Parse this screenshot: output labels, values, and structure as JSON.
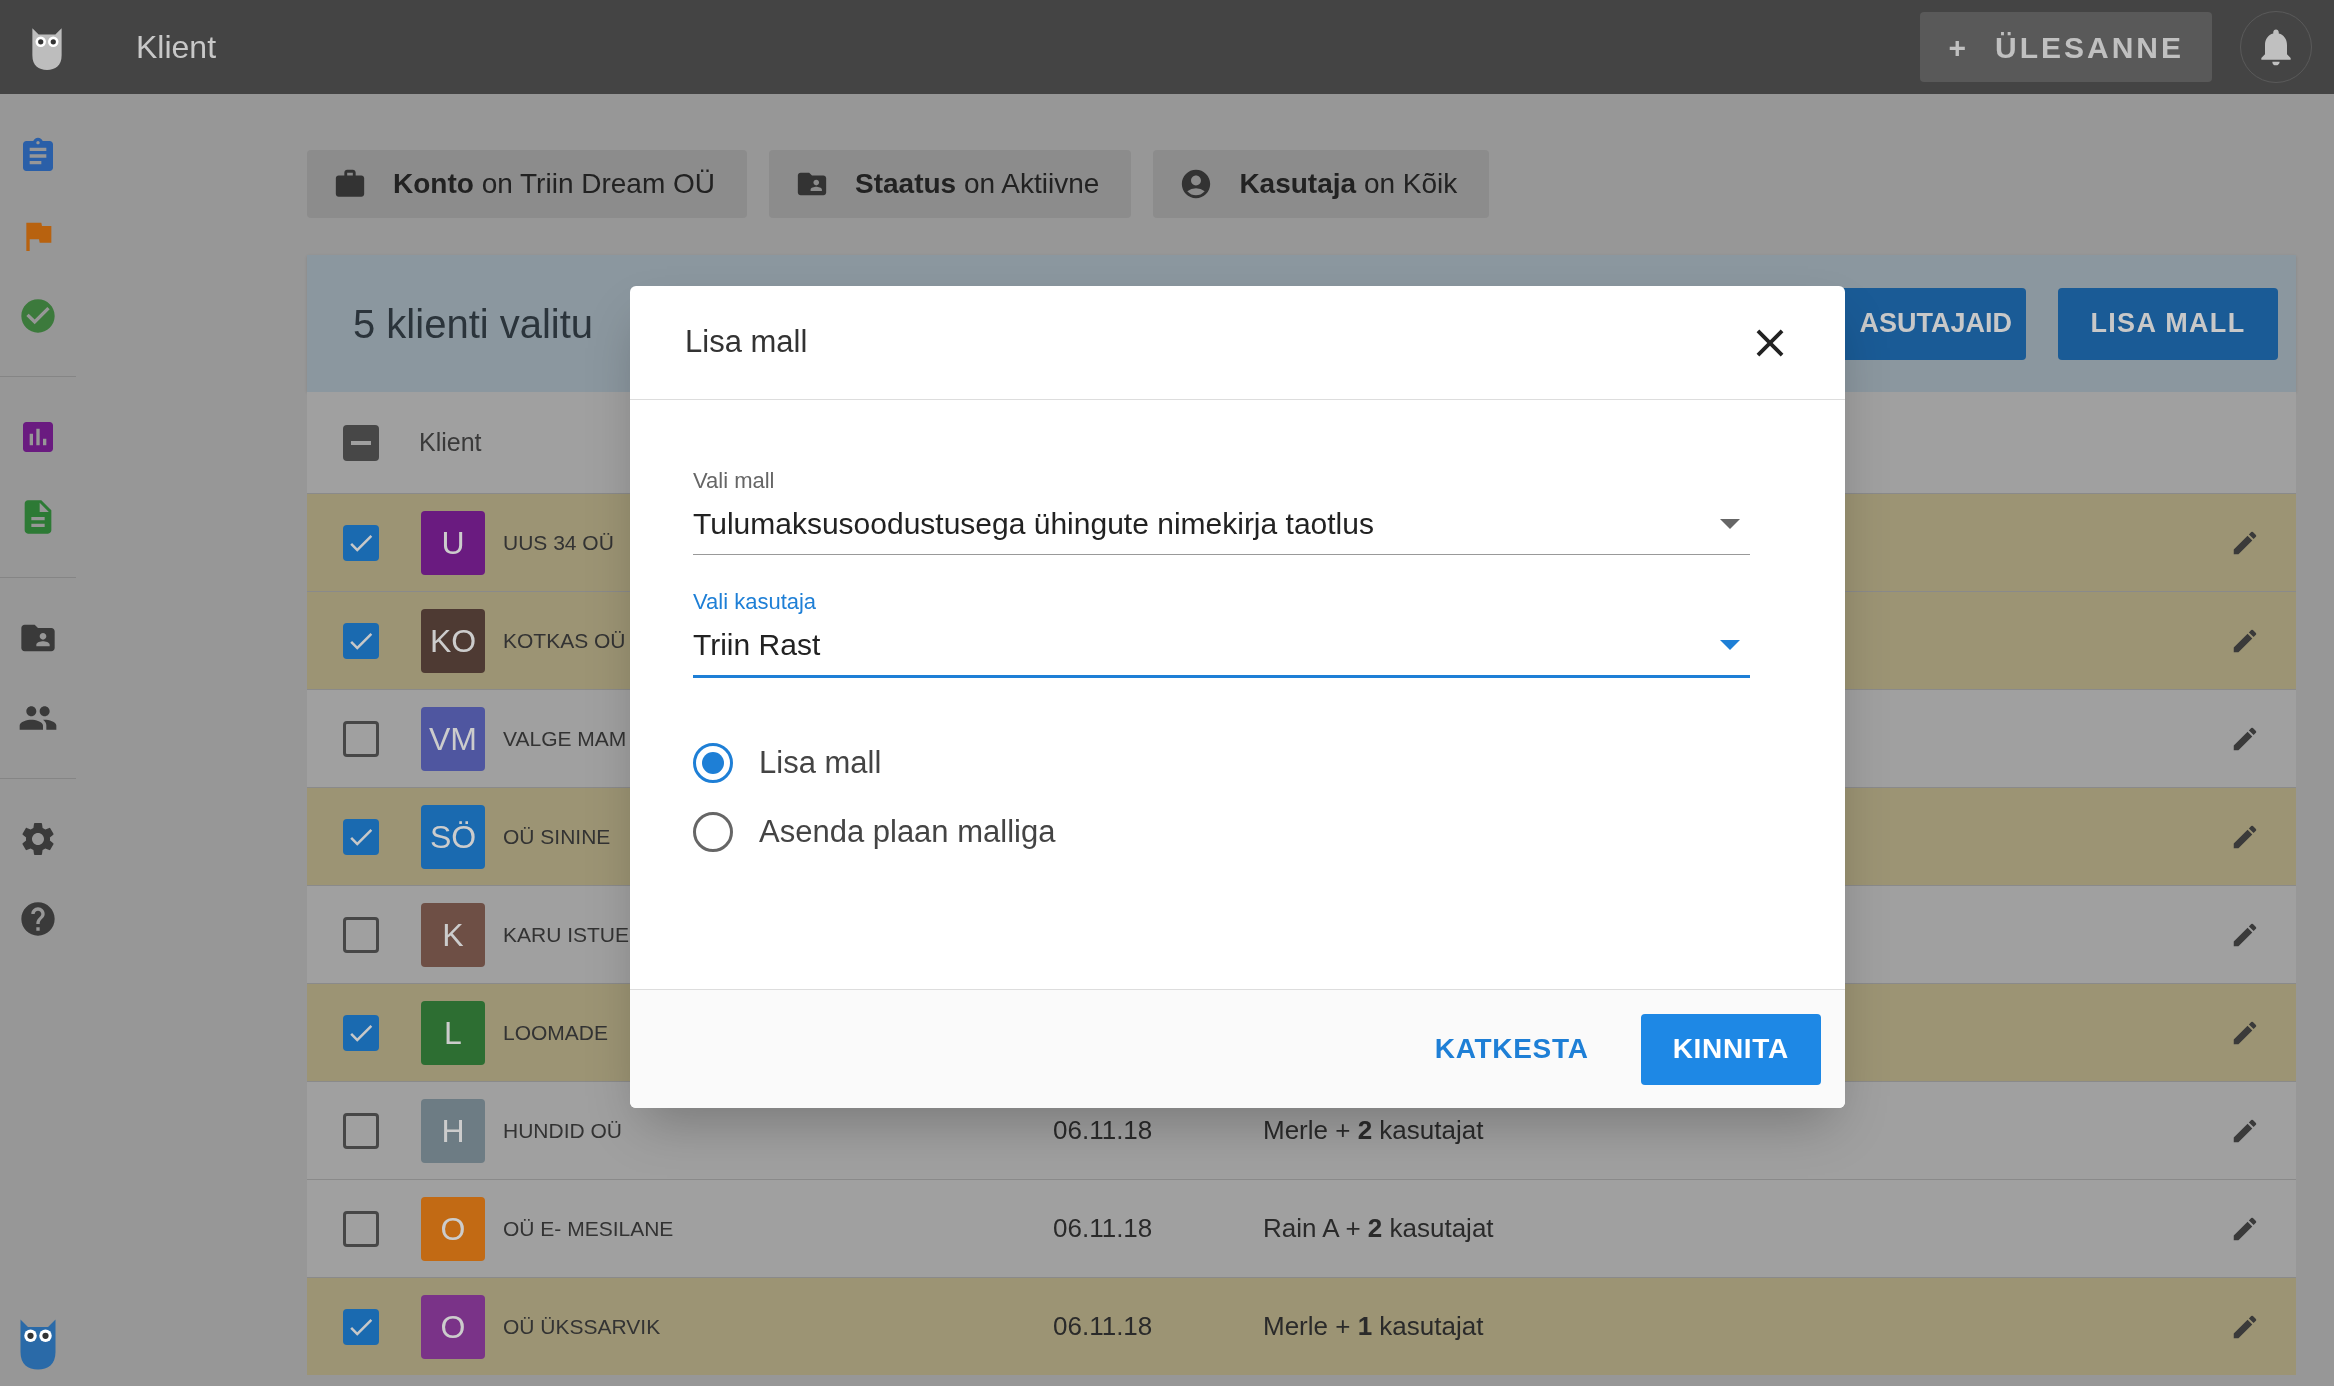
{
  "app_bar": {
    "title": "Klient",
    "task_button": {
      "icon": "+",
      "label": "ÜLESANNE"
    }
  },
  "filters": [
    {
      "kind": "account",
      "text": "**Konto** on Triin Dream OÜ"
    },
    {
      "kind": "status",
      "text": "**Staatus** on Aktiivne"
    },
    {
      "kind": "user",
      "text": "**Kasutaja** on Kõik"
    }
  ],
  "selection_bar": {
    "title": "5 klienti valitu",
    "buttons": [
      "ASUTAJAID",
      "LISA MALL"
    ]
  },
  "table": {
    "header": {
      "indeterminate": true,
      "column": "Klient"
    },
    "rows": [
      {
        "checked": true,
        "initials": "U",
        "color": "#6a1b80",
        "name": "UUS 34 OÜ"
      },
      {
        "checked": true,
        "initials": "KO",
        "color": "#4e3a33",
        "name": "KOTKAS OÜ"
      },
      {
        "checked": false,
        "initials": "VM",
        "color": "#4f56a0",
        "name": "VALGE MAM"
      },
      {
        "checked": true,
        "initials": "SÖ",
        "color": "#1a6ab0",
        "name": "OÜ SININE"
      },
      {
        "checked": false,
        "initials": "K",
        "color": "#6e4f45",
        "name": "KARU ISTUE"
      },
      {
        "checked": true,
        "initials": "L",
        "color": "#2d6e32",
        "name": "LOOMADE"
      },
      {
        "checked": false,
        "initials": "H",
        "color": "#6d7c84",
        "name": "HUNDID OÜ",
        "date": "06.11.18",
        "users": "Merle + **2** kasutajat"
      },
      {
        "checked": false,
        "initials": "O",
        "color": "#c26a14",
        "name": "OÜ E- MESILANE",
        "date": "06.11.18",
        "users": "Rain A + **2** kasutajat"
      },
      {
        "checked": true,
        "initials": "O",
        "color": "#7a3388",
        "name": "OÜ ÜKSSARVIK",
        "date": "06.11.18",
        "users": "Merle + **1** kasutajat"
      }
    ]
  },
  "dialog": {
    "title": "Lisa mall",
    "fields": [
      {
        "label": "Vali mall",
        "value": "Tulumaksusoodustusega ühingute nimekirja taotlus",
        "focused": false
      },
      {
        "label": "Vali kasutaja",
        "value": "Triin Rast",
        "focused": true
      }
    ],
    "options": [
      {
        "label": "Lisa mall",
        "selected": true
      },
      {
        "label": "Asenda plaan malliga",
        "selected": false
      }
    ],
    "actions": [
      {
        "kind": "text",
        "label": "KATKESTA"
      },
      {
        "kind": "primary",
        "label": "KINNITA"
      }
    ]
  }
}
